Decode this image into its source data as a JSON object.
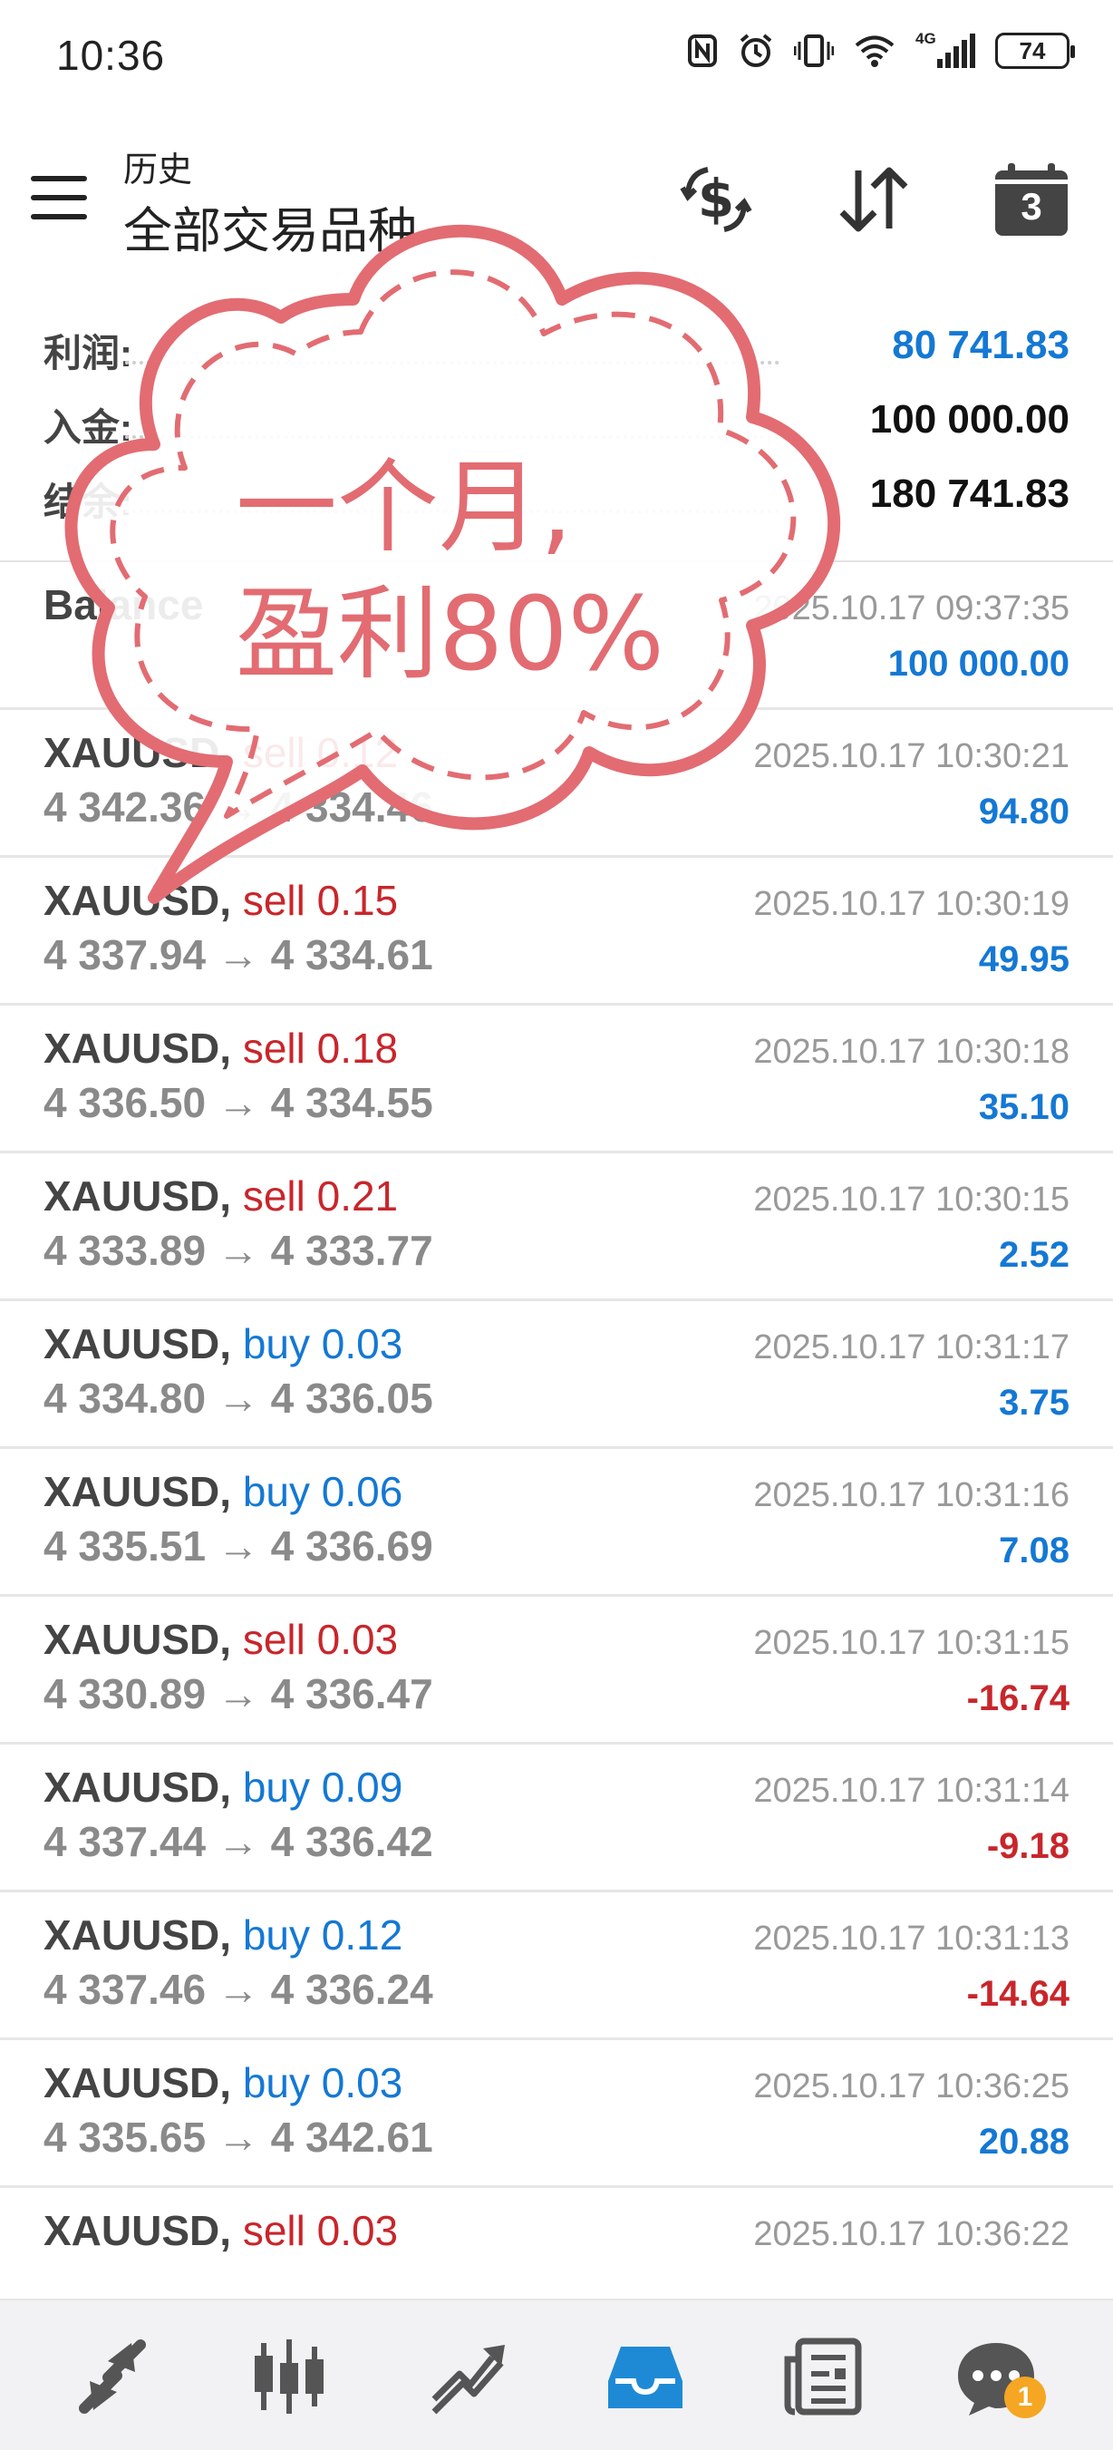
{
  "status_bar": {
    "time": "10:36",
    "battery": "74",
    "network": "4G"
  },
  "header": {
    "subtitle": "历史",
    "title": "全部交易品种"
  },
  "header_badge": "3",
  "summary": [
    {
      "label": "利润:",
      "value": "80 741.83",
      "color": "#1478d4"
    },
    {
      "label": "入金:",
      "value": "100 000.00",
      "color": "#111111"
    },
    {
      "label": "结余:",
      "value": "180 741.83",
      "color": "#111111"
    }
  ],
  "balance_row": {
    "label": "Balance",
    "time": "2025.10.17 09:37:35",
    "amount": "100 000.00"
  },
  "trades": [
    {
      "symbol": "XAUUSD,",
      "side": "sell 0.12",
      "side_color": "#c8262b",
      "prices": "4 342.36 → 4 334.46",
      "time": "2025.10.17 10:30:21",
      "profit": "94.80",
      "profit_color": "#1478d4"
    },
    {
      "symbol": "XAUUSD,",
      "side": "sell 0.15",
      "side_color": "#c8262b",
      "prices": "4 337.94 → 4 334.61",
      "time": "2025.10.17 10:30:19",
      "profit": "49.95",
      "profit_color": "#1478d4"
    },
    {
      "symbol": "XAUUSD,",
      "side": "sell 0.18",
      "side_color": "#c8262b",
      "prices": "4 336.50 → 4 334.55",
      "time": "2025.10.17 10:30:18",
      "profit": "35.10",
      "profit_color": "#1478d4"
    },
    {
      "symbol": "XAUUSD,",
      "side": "sell 0.21",
      "side_color": "#c8262b",
      "prices": "4 333.89 → 4 333.77",
      "time": "2025.10.17 10:30:15",
      "profit": "2.52",
      "profit_color": "#1478d4"
    },
    {
      "symbol": "XAUUSD,",
      "side": "buy 0.03",
      "side_color": "#1478d4",
      "prices": "4 334.80 → 4 336.05",
      "time": "2025.10.17 10:31:17",
      "profit": "3.75",
      "profit_color": "#1478d4"
    },
    {
      "symbol": "XAUUSD,",
      "side": "buy 0.06",
      "side_color": "#1478d4",
      "prices": "4 335.51 → 4 336.69",
      "time": "2025.10.17 10:31:16",
      "profit": "7.08",
      "profit_color": "#1478d4"
    },
    {
      "symbol": "XAUUSD,",
      "side": "sell 0.03",
      "side_color": "#c8262b",
      "prices": "4 330.89 → 4 336.47",
      "time": "2025.10.17 10:31:15",
      "profit": "-16.74",
      "profit_color": "#c8262b"
    },
    {
      "symbol": "XAUUSD,",
      "side": "buy 0.09",
      "side_color": "#1478d4",
      "prices": "4 337.44 → 4 336.42",
      "time": "2025.10.17 10:31:14",
      "profit": "-9.18",
      "profit_color": "#c8262b"
    },
    {
      "symbol": "XAUUSD,",
      "side": "buy 0.12",
      "side_color": "#1478d4",
      "prices": "4 337.46 → 4 336.24",
      "time": "2025.10.17 10:31:13",
      "profit": "-14.64",
      "profit_color": "#c8262b"
    },
    {
      "symbol": "XAUUSD,",
      "side": "buy 0.03",
      "side_color": "#1478d4",
      "prices": "4 335.65 → 4 342.61",
      "time": "2025.10.17 10:36:25",
      "profit": "20.88",
      "profit_color": "#1478d4"
    },
    {
      "symbol": "XAUUSD,",
      "side": "sell 0.03",
      "side_color": "#c8262b",
      "prices": "",
      "time": "2025.10.17 10:36:22",
      "profit": "",
      "profit_color": "#1478d4"
    }
  ],
  "overlay": {
    "line1": "一个月,",
    "line2": "盈利80%"
  },
  "bottom_nav": {
    "items": [
      "quotes-icon",
      "chart-icon",
      "trade-icon",
      "history-icon",
      "news-icon",
      "messages-icon"
    ],
    "active": "history-icon",
    "messages_badge": "1"
  },
  "colors": {
    "accent_blue": "#1478d4",
    "sell_red": "#c8262b",
    "sticker_pink": "#e26c72"
  }
}
